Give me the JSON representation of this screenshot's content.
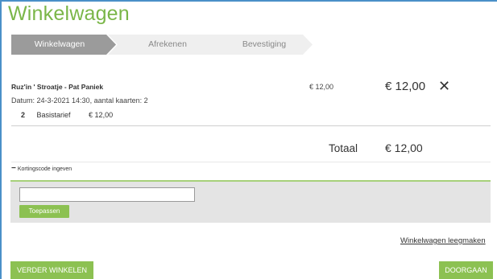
{
  "page": {
    "title": "Winkelwagen"
  },
  "steps": [
    {
      "label": "Winkelwagen",
      "active": true
    },
    {
      "label": "Afrekenen",
      "active": false
    },
    {
      "label": "Bevestiging",
      "active": false
    }
  ],
  "colors": {
    "brand_green": "#7ab648",
    "button_green": "#8cc152",
    "step_active": "#9b9b9b",
    "step_inactive": "#efefef"
  },
  "cart": {
    "items": [
      {
        "event_name": "Ruz'in ' Stroatje - Pat Paniek",
        "date_line": "Datum: 24-3-2021 14:30, aantal kaarten: 2",
        "unit_price": "€ 12,00",
        "line_total": "€ 12,00",
        "remove_glyph": "✕",
        "tickets": [
          {
            "qty": "2",
            "type": "Basistarief",
            "price": "€ 12,00"
          }
        ]
      }
    ],
    "total_label": "Totaal",
    "total_value": "€ 12,00"
  },
  "coupon": {
    "toggle_symbol": "−",
    "toggle_label": "Kortingscode ingeven",
    "input_value": "",
    "apply_label": "Toepassen"
  },
  "actions": {
    "empty_cart_label": "Winkelwagen leegmaken",
    "continue_shopping_label": "VERDER WINKELEN",
    "proceed_label": "DOORGAAN"
  }
}
